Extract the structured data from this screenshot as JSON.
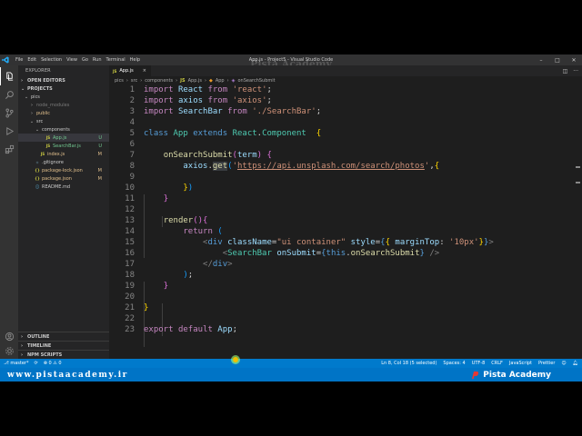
{
  "window": {
    "title": "App.js - Project5 - Visual Studio Code",
    "watermark": "Pista Academy",
    "menu": [
      "File",
      "Edit",
      "Selection",
      "View",
      "Go",
      "Run",
      "Terminal",
      "Help"
    ]
  },
  "sidebar": {
    "header": "EXPLORER",
    "open_editors": "OPEN EDITORS",
    "project": "PROJECTS",
    "tree": [
      {
        "label": "pics",
        "indent": 1,
        "type": "folder-open",
        "badge": ""
      },
      {
        "label": "node_modules",
        "indent": 2,
        "type": "folder",
        "badge": "",
        "dim": true
      },
      {
        "label": "public",
        "indent": 2,
        "type": "folder",
        "badge": "",
        "color": "#e2c08d"
      },
      {
        "label": "src",
        "indent": 2,
        "type": "folder-open",
        "badge": ""
      },
      {
        "label": "components",
        "indent": 3,
        "type": "folder-open",
        "badge": ""
      },
      {
        "label": "App.js",
        "indent": 4,
        "type": "js",
        "badge": "U",
        "color": "#73c991",
        "selected": true
      },
      {
        "label": "SearchBar.js",
        "indent": 4,
        "type": "js",
        "badge": "U",
        "color": "#73c991"
      },
      {
        "label": "index.js",
        "indent": 3,
        "type": "js",
        "badge": "M",
        "color": "#e2c08d"
      },
      {
        "label": ".gitignore",
        "indent": 2,
        "type": "git",
        "badge": ""
      },
      {
        "label": "package-lock.json",
        "indent": 2,
        "type": "json",
        "badge": "M",
        "color": "#e2c08d"
      },
      {
        "label": "package.json",
        "indent": 2,
        "type": "json",
        "badge": "M",
        "color": "#e2c08d"
      },
      {
        "label": "README.md",
        "indent": 2,
        "type": "md",
        "badge": ""
      }
    ],
    "outline": "OUTLINE",
    "timeline": "TIMELINE",
    "npm_scripts": "NPM SCRIPTS"
  },
  "editor": {
    "tab_label": "App.js",
    "tab_icon": "JS",
    "breadcrumb": [
      "pics",
      "src",
      "components",
      "App.js",
      "App",
      "onSearchSubmit"
    ],
    "line_numbers": [
      "1",
      "2",
      "3",
      "4",
      "5",
      "6",
      "7",
      "8",
      "9",
      "10",
      "11",
      "12",
      "13",
      "14",
      "15",
      "16",
      "17",
      "18",
      "19",
      "20",
      "21",
      "22",
      "23"
    ]
  },
  "status": {
    "branch": "master*",
    "sync": "⟳",
    "problems": "⊗ 0  ⚠ 0",
    "position": "Ln 8, Col 18 (5 selected)",
    "spaces": "Spaces: 4",
    "encoding": "UTF-8",
    "eol": "CRLF",
    "language": "JavaScript",
    "formatter": "Prettier"
  },
  "brand": {
    "website": "www.pistaacademy.ir",
    "name": "Pista Academy"
  },
  "colors": {
    "accent": "#007acc",
    "editor_bg": "#1e1e1e",
    "sidebar_bg": "#252526"
  }
}
